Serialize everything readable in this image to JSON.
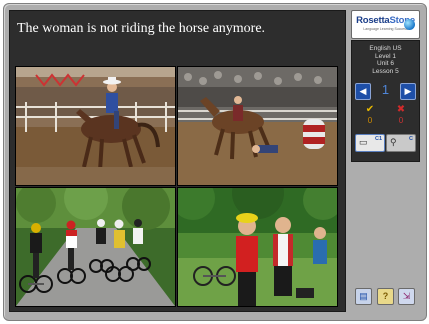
{
  "prompt": {
    "text": "The woman is not riding the horse anymore."
  },
  "logo": {
    "brand_a": "Rosetta",
    "brand_b": "Stone",
    "tagline": "Language Learning Success"
  },
  "course": {
    "language": "English US",
    "level": "Level 1",
    "unit": "Unit 6",
    "lesson": "Lesson 5"
  },
  "navigation": {
    "prev_icon": "arrow-left-icon",
    "prev_glyph": "◀",
    "next_icon": "arrow-right-icon",
    "next_glyph": "▶",
    "current_page": "1"
  },
  "score": {
    "correct_glyph": "✔",
    "correct": "0",
    "wrong_glyph": "✖",
    "wrong": "0"
  },
  "modes": [
    {
      "label": "C1",
      "icon": "book-icon",
      "glyph": "▭",
      "selected": true
    },
    {
      "label": "C",
      "icon": "magnifier-icon",
      "glyph": "⚲",
      "selected": false
    }
  ],
  "photos": [
    {
      "subject": "rider-on-horse-arena"
    },
    {
      "subject": "rider-fallen-from-horse"
    },
    {
      "subject": "cyclists-on-road"
    },
    {
      "subject": "cyclists-resting"
    }
  ],
  "bottom_buttons": [
    {
      "icon": "translate-icon",
      "glyph": "▤"
    },
    {
      "icon": "help-icon",
      "glyph": "?"
    },
    {
      "icon": "exit-icon",
      "glyph": "⇲"
    }
  ],
  "colors": {
    "panel": "#2d2d2d",
    "frame": "#adadad",
    "accent_blue": "#1e4fa8",
    "score_yellow": "#e6b800",
    "score_red": "#d02b2b"
  }
}
